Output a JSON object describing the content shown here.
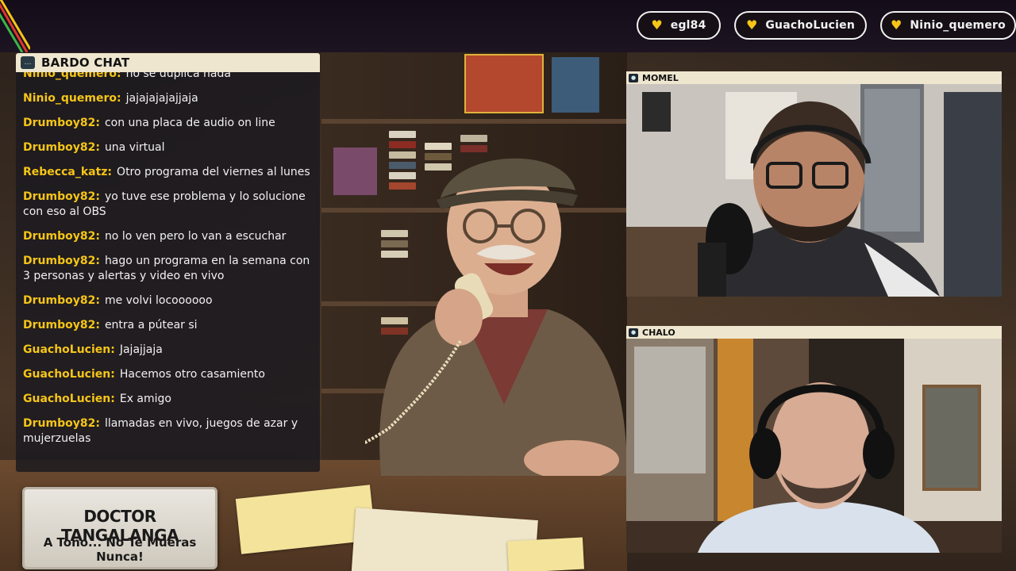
{
  "users": [
    {
      "name": "egl84"
    },
    {
      "name": "GuachoLucien"
    },
    {
      "name": "Ninio_quemero"
    }
  ],
  "chat": {
    "title": "BARDO CHAT",
    "messages": [
      {
        "author": "Ninio_quemero:",
        "text": "no se duplica nada"
      },
      {
        "author": "Ninio_quemero:",
        "text": "jajajajajajjaja"
      },
      {
        "author": "Drumboy82:",
        "text": "con una placa de audio on line"
      },
      {
        "author": "Drumboy82:",
        "text": "una virtual"
      },
      {
        "author": "Rebecca_katz:",
        "text": "Otro programa del viernes al lunes"
      },
      {
        "author": "Drumboy82:",
        "text": "yo tuve ese problema y lo solucione con eso al OBS"
      },
      {
        "author": "Drumboy82:",
        "text": "no lo ven pero lo van a escuchar"
      },
      {
        "author": "Drumboy82:",
        "text": "hago un programa en la semana con 3 personas y alertas y video en vivo"
      },
      {
        "author": "Drumboy82:",
        "text": "me volvi locoooooo"
      },
      {
        "author": "Drumboy82:",
        "text": "entra a pútear si"
      },
      {
        "author": "GuachoLucien:",
        "text": "Jajajjaja"
      },
      {
        "author": "GuachoLucien:",
        "text": "Hacemos otro casamiento"
      },
      {
        "author": "GuachoLucien:",
        "text": "Ex amigo"
      },
      {
        "author": "Drumboy82:",
        "text": "llamadas en vivo, juegos de azar y mujerzuelas"
      }
    ]
  },
  "cams": [
    {
      "name": "MOMEL"
    },
    {
      "name": "CHALO"
    }
  ],
  "sign": {
    "line1": "DOCTOR TANGALANGA",
    "line2": "A Tono... No Te Mueras Nunca!"
  },
  "icons": {
    "heart": "heart-icon",
    "chat": "chat-bubble-icon",
    "camera": "camera-icon"
  },
  "colors": {
    "accent": "#f5c518",
    "label_bg": "#efe6cf",
    "pill_border": "#f2f2f2"
  }
}
